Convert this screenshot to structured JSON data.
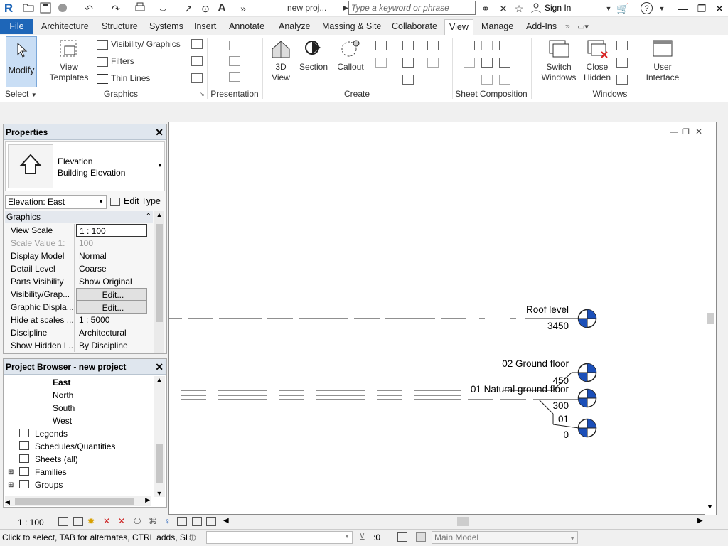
{
  "titlebar": {
    "app_icon": "R",
    "title": "new proj...",
    "search_placeholder": "Type a keyword or phrase",
    "sign_in": "Sign In",
    "icons": [
      "open-icon",
      "save-icon",
      "sync-icon",
      "undo-icon",
      "redo-icon",
      "print-icon",
      "measure-icon",
      "dimension-icon",
      "tag-icon",
      "text-icon",
      "more-icon",
      "binoculars-icon",
      "star-icon",
      "user-icon",
      "cart-icon",
      "help-icon"
    ]
  },
  "tabs": [
    "File",
    "Architecture",
    "Structure",
    "Systems",
    "Insert",
    "Annotate",
    "Analyze",
    "Massing & Site",
    "Collaborate",
    "View",
    "Manage",
    "Add-Ins"
  ],
  "active_tab": "View",
  "ribbon": {
    "modify": "Modify",
    "select": "Select",
    "view_templates": "View Templates",
    "visibility": "Visibility/ Graphics",
    "filters": "Filters",
    "thin_lines": "Thin  Lines",
    "graphics": "Graphics",
    "presentation": "Presentation",
    "three_d": "3D View",
    "section": "Section",
    "callout": "Callout",
    "create": "Create",
    "sheet_composition": "Sheet Composition",
    "switch_windows": "Switch Windows",
    "close_hidden": "Close Hidden",
    "user_interface": "User Interface",
    "windows": "Windows"
  },
  "properties": {
    "title": "Properties",
    "type_name1": "Elevation",
    "type_name2": "Building Elevation",
    "instance": "Elevation: East",
    "edit_type": "Edit Type",
    "section": "Graphics",
    "rows": [
      {
        "k": "View Scale",
        "v": "1 : 100"
      },
      {
        "k": "Scale Value    1:",
        "v": "100"
      },
      {
        "k": "Display Model",
        "v": "Normal"
      },
      {
        "k": "Detail Level",
        "v": "Coarse"
      },
      {
        "k": "Parts Visibility",
        "v": "Show Original"
      },
      {
        "k": "Visibility/Grap...",
        "v": "Edit..."
      },
      {
        "k": "Graphic Displa...",
        "v": "Edit..."
      },
      {
        "k": "Hide at scales ...",
        "v": "1 : 5000"
      },
      {
        "k": "Discipline",
        "v": "Architectural"
      },
      {
        "k": "Show Hidden L...",
        "v": "By Discipline"
      }
    ]
  },
  "browser": {
    "title": "Project Browser - new project",
    "items": [
      "East",
      "North",
      "South",
      "West",
      "Legends",
      "Schedules/Quantities",
      "Sheets (all)",
      "Families",
      "Groups"
    ]
  },
  "canvas": {
    "levels": [
      {
        "name": "Roof level",
        "elev": "3450"
      },
      {
        "name": "02 Ground floor",
        "elev": "450"
      },
      {
        "name": "01 Natural ground floor",
        "elev": "300"
      },
      {
        "name": "01",
        "elev": "0"
      }
    ]
  },
  "viewbar": {
    "scale": "1 : 100"
  },
  "statusbar": {
    "message": "Click to select, TAB for alternates, CTRL adds, SHI",
    "count": ":0",
    "model": "Main Model"
  },
  "colors": {
    "file_tab": "#1e66b8",
    "level_symbol": "#1b4fb8",
    "accent": "#2a6ebb"
  }
}
